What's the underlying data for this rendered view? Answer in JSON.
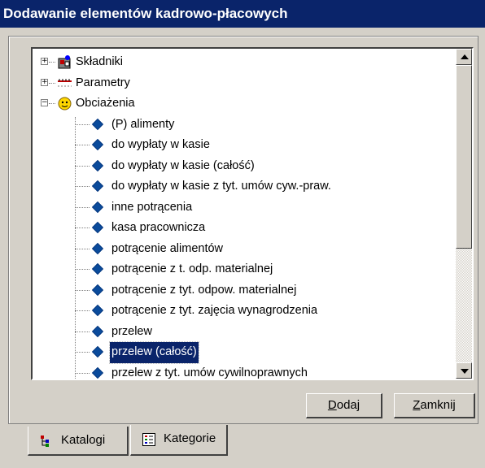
{
  "window": {
    "title": "Dodawanie elementów kadrowo-płacowych"
  },
  "tree": {
    "groups": [
      {
        "label": "Składniki",
        "expander": "+",
        "icon": "money-bag-icon"
      },
      {
        "label": "Parametry",
        "expander": "+",
        "icon": "ruler-icon"
      },
      {
        "label": "Obciażenia",
        "expander": "−",
        "icon": "smiley-icon"
      }
    ],
    "items": [
      "(P) alimenty",
      "do wypłaty w kasie",
      "do wypłaty w kasie (całość)",
      "do wypłaty w kasie z tyt. umów cyw.-praw.",
      "inne potrącenia",
      "kasa pracownicza",
      "potrącenie alimentów",
      "potrącenie z t. odp. materialnej",
      "potrącenie z tyt. odpow. materialnej",
      "potrącenie z tyt. zajęcia wynagrodzenia",
      "przelew",
      "przelew (całość)",
      "przelew z tyt. umów cywilnoprawnych"
    ],
    "selected_item": "przelew (całość)"
  },
  "buttons": {
    "add_label": "Dodaj",
    "add_hotkey": "D",
    "close_label": "Zamknij",
    "close_hotkey": "Z"
  },
  "tabs": [
    {
      "label": "Katalogi",
      "active": false
    },
    {
      "label": "Kategorie",
      "active": true
    }
  ],
  "colors": {
    "titlebar": "#0a246a",
    "selection": "#0a246a",
    "face": "#d4d0c8",
    "item_icon": "#0a4b9c"
  }
}
